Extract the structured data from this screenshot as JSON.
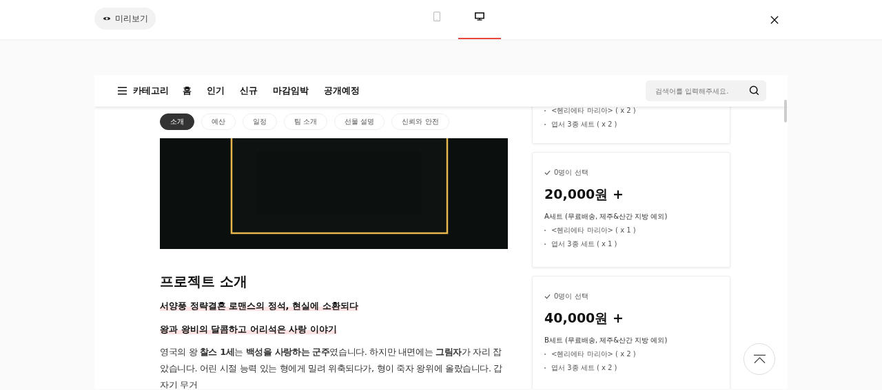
{
  "toolbar": {
    "preview_button": "미리보기",
    "device_tabs": [
      {
        "kind": "tablet",
        "selected": false
      },
      {
        "kind": "desktop",
        "selected": true
      }
    ]
  },
  "nav": {
    "category": "카테고리",
    "links": [
      "홈",
      "인기",
      "신규",
      "마감임박",
      "공개예정"
    ],
    "search": {
      "placeholder": "검색어를 입력해주세요."
    }
  },
  "section_tabs": [
    {
      "label": "소개",
      "selected": true
    },
    {
      "label": "예산",
      "selected": false
    },
    {
      "label": "일정",
      "selected": false
    },
    {
      "label": "팀 소개",
      "selected": false
    },
    {
      "label": "선물 설명",
      "selected": false
    },
    {
      "label": "신뢰와 안전",
      "selected": false
    }
  ],
  "story": {
    "heading": "프로젝트 소개",
    "highlights": [
      "서양풍 정략결혼 로맨스의 정석, 현실에 소환되다",
      "왕과 왕비의 달콤하고 어리석은 사랑 이야기"
    ],
    "paragraph": "영국의 왕 **찰스 1세**는 **백성을 사랑하는 군주**였습니다. 하지만 내면에는 **그림자**가 자리 잡았습니다. 어린 시절 능력 있는 형에게 밀려 위축되다가, 형이 죽자 왕위에 올랐습니다. 갑자기 무거"
  },
  "rewards": [
    {
      "items": [
        "<헨리에타 마리아> ( x 2 )",
        "엽서 3종 세트 ( x 2 )"
      ]
    },
    {
      "selected_count": "0명이 선택",
      "price": "20,000원 +",
      "title": "A세트 (무료배송, 제주&산간 지방 예외)",
      "items": [
        "<헨리에타 마리아> ( x 1 )",
        "엽서 3종 세트 ( x 1 )"
      ]
    },
    {
      "selected_count": "0명이 선택",
      "price": "40,000원 +",
      "title": "B세트 (무료배송, 제주&산간 지방 예외)",
      "items": [
        "<헨리에타 마리아> ( x 2 )",
        "엽서 3종 세트 ( x 2 )"
      ]
    }
  ]
}
